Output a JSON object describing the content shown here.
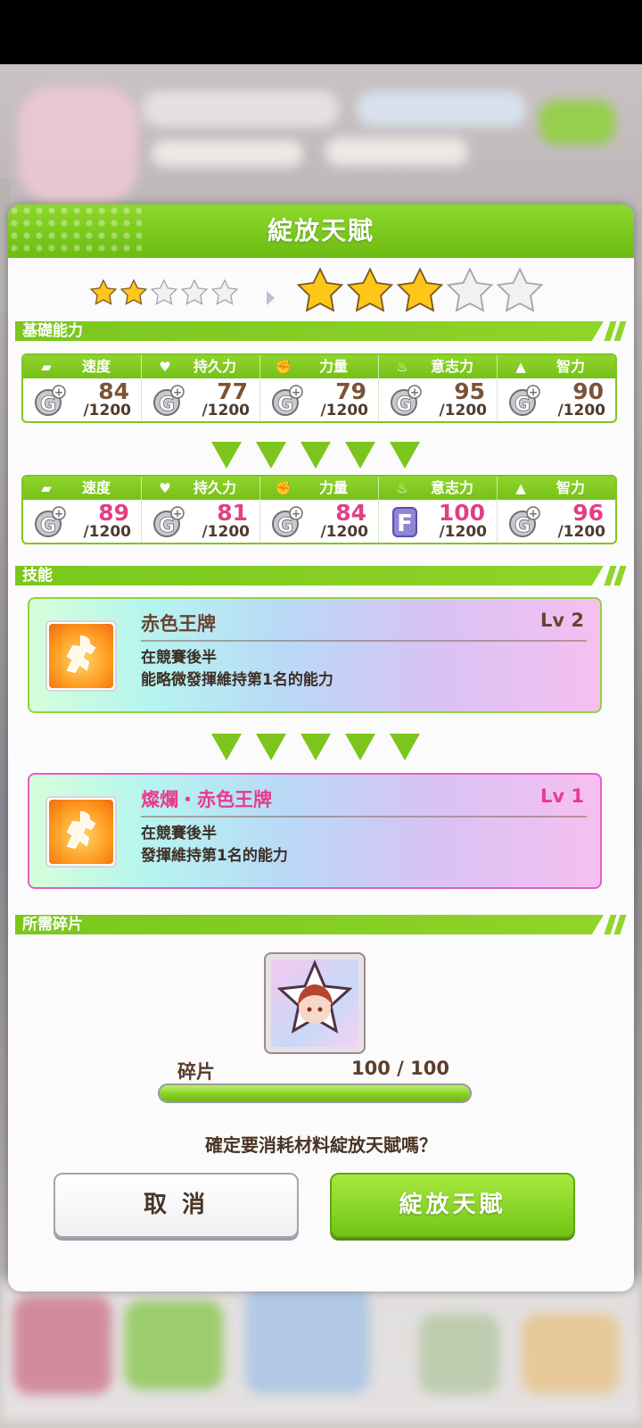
{
  "modal": {
    "title": "綻放天賦",
    "stars": {
      "before": 2,
      "after": 3,
      "max": 5
    }
  },
  "sections": {
    "base": "基礎能力",
    "skill": "技能",
    "pieces": "所需碎片"
  },
  "stats_before": [
    {
      "icon": "shoe-icon",
      "name": "速度",
      "rank": "G+",
      "value": "84",
      "max": "/1200"
    },
    {
      "icon": "heart-icon",
      "name": "持久力",
      "rank": "G+",
      "value": "77",
      "max": "/1200"
    },
    {
      "icon": "muscle-icon",
      "name": "力量",
      "rank": "G+",
      "value": "79",
      "max": "/1200"
    },
    {
      "icon": "flame-icon",
      "name": "意志力",
      "rank": "G+",
      "value": "95",
      "max": "/1200"
    },
    {
      "icon": "graduation-cap-icon",
      "name": "智力",
      "rank": "G+",
      "value": "90",
      "max": "/1200"
    }
  ],
  "stats_after": [
    {
      "icon": "shoe-icon",
      "name": "速度",
      "rank": "G+",
      "value": "89",
      "max": "/1200"
    },
    {
      "icon": "heart-icon",
      "name": "持久力",
      "rank": "G+",
      "value": "81",
      "max": "/1200"
    },
    {
      "icon": "muscle-icon",
      "name": "力量",
      "rank": "G+",
      "value": "84",
      "max": "/1200"
    },
    {
      "icon": "flame-icon",
      "name": "意志力",
      "rank": "F",
      "value": "100",
      "max": "/1200"
    },
    {
      "icon": "graduation-cap-icon",
      "name": "智力",
      "rank": "G+",
      "value": "96",
      "max": "/1200"
    }
  ],
  "skills": {
    "before": {
      "name": "赤色王牌",
      "level": "Lv 2",
      "desc": "在競賽後半\n能略微發揮維持第1名的能力"
    },
    "after": {
      "name": "燦爛・赤色王牌",
      "level": "Lv 1",
      "desc": "在競賽後半\n發揮維持第1名的能力"
    }
  },
  "pieces": {
    "label": "碎片",
    "count": "100 / 100",
    "progress": 1.0
  },
  "confirm_text": "確定要消耗材料綻放天賦嗎？",
  "buttons": {
    "cancel": "取 消",
    "ok": "綻放天賦"
  },
  "colors": {
    "accent": "#7cc51c",
    "highlight": "#e23f85",
    "text": "#6a4330"
  }
}
